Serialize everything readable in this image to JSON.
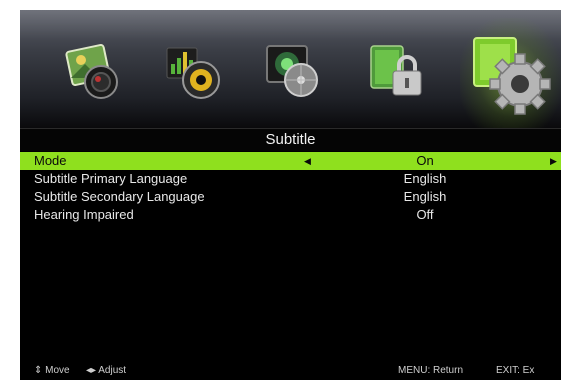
{
  "menu_icons": [
    {
      "name": "picture-icon"
    },
    {
      "name": "sound-icon"
    },
    {
      "name": "channel-icon"
    },
    {
      "name": "lock-icon"
    },
    {
      "name": "setup-icon",
      "selected": true
    }
  ],
  "title": "Subtitle",
  "rows": [
    {
      "label": "Mode",
      "value": "On",
      "highlighted": true
    },
    {
      "label": "Subtitle Primary Language",
      "value": "English"
    },
    {
      "label": "Subtitle Secondary Language",
      "value": "English"
    },
    {
      "label": "Hearing Impaired",
      "value": "Off"
    }
  ],
  "arrows": {
    "left": "◀",
    "right": "▶"
  },
  "footer": {
    "move": "⇕ Move",
    "adjust": "◂▸ Adjust",
    "menu_return": "MENU: Return",
    "exit": "EXIT: Ex"
  },
  "colors": {
    "highlight": "#8fe01e",
    "background": "#000000"
  }
}
